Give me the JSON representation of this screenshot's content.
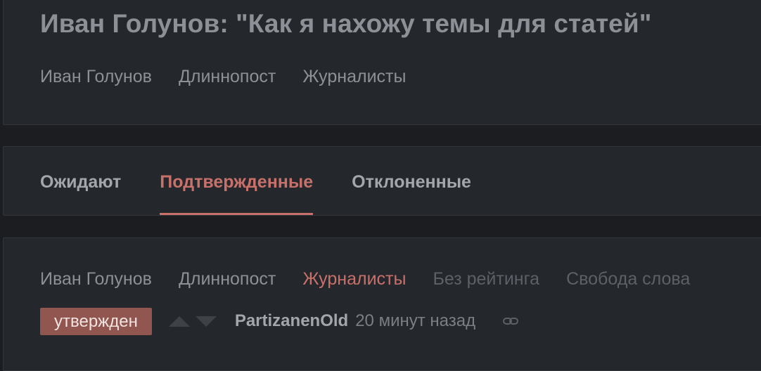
{
  "story": {
    "title": "Иван Голунов: \"Как я нахожу темы для статей\"",
    "tags": [
      "Иван Голунов",
      "Длиннопост",
      "Журналисты"
    ]
  },
  "tabs": [
    {
      "label": "Ожидают",
      "active": false
    },
    {
      "label": "Подтвержденные",
      "active": true
    },
    {
      "label": "Отклоненные",
      "active": false
    }
  ],
  "entry": {
    "tags": [
      "Иван Голунов",
      "Длиннопост",
      "Журналисты",
      "Без рейтинга",
      "Свобода слова"
    ],
    "status": "утвержден",
    "author": "PartizanenOld",
    "time": "20 минут назад",
    "icons": {
      "vote_up": "arrow-up-icon",
      "vote_down": "arrow-down-icon",
      "link": "link-icon"
    }
  },
  "colors": {
    "background": "#1b1d20",
    "panel": "#24272b",
    "accent": "#c8716b",
    "badge": "#925650"
  }
}
